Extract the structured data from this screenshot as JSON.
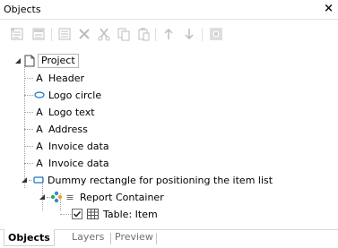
{
  "window": {
    "title": "Objects",
    "close_label": "×"
  },
  "toolbar": {
    "buttons": [
      {
        "icon": "new-object-icon"
      },
      {
        "icon": "new-object-alt-icon"
      },
      {
        "icon": "properties-icon"
      },
      {
        "icon": "delete-icon"
      },
      {
        "icon": "cut-icon"
      },
      {
        "icon": "copy-icon"
      },
      {
        "icon": "paste-icon"
      },
      {
        "icon": "move-up-icon"
      },
      {
        "icon": "move-down-icon"
      },
      {
        "icon": "screenshot-icon"
      }
    ]
  },
  "tree": {
    "root": {
      "label": "Project",
      "icon": "page-icon"
    },
    "items": [
      {
        "label": "Header",
        "icon": "text-object-icon",
        "glyph": "A"
      },
      {
        "label": "Logo circle",
        "icon": "ellipse-icon",
        "glyph": ""
      },
      {
        "label": "Logo text",
        "icon": "text-object-icon",
        "glyph": "A"
      },
      {
        "label": "Address",
        "icon": "text-object-icon",
        "glyph": "A"
      },
      {
        "label": "Invoice data",
        "icon": "text-object-icon",
        "glyph": "A"
      },
      {
        "label": "Invoice data",
        "icon": "text-object-icon",
        "glyph": "A"
      },
      {
        "label": "Dummy rectangle for positioning the item list",
        "icon": "rectangle-icon",
        "glyph": ""
      }
    ],
    "container": {
      "label": "Report Container",
      "icon": "report-container-icon"
    },
    "table": {
      "label": "Table: Item",
      "icon": "table-icon",
      "checked": true
    }
  },
  "tabs": [
    {
      "label": "Objects",
      "active": true
    },
    {
      "label": "Layers",
      "active": false
    },
    {
      "label": "Preview",
      "active": false
    }
  ]
}
